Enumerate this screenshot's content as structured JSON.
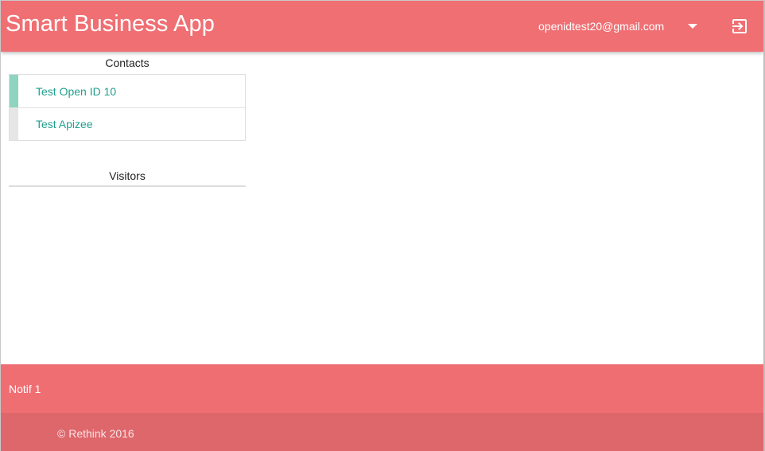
{
  "header": {
    "app_title": "Smart Business App",
    "user_email": "openidtest20@gmail.com",
    "dropdown_icon": "caret-down-icon",
    "logout_icon": "exit-to-app-icon",
    "color": "#ef6f73"
  },
  "sidebar": {
    "contacts_title": "Contacts",
    "contacts": [
      {
        "name": "Test Open ID 10",
        "status_color": "#8fd3c1"
      },
      {
        "name": "Test Apizee",
        "status_color": "#e6e6e6"
      }
    ],
    "visitors_title": "Visitors"
  },
  "notification": {
    "text": "Notif 1",
    "color": "#ef6e72"
  },
  "footer": {
    "copyright": "© Rethink 2016",
    "color": "#de676c"
  }
}
